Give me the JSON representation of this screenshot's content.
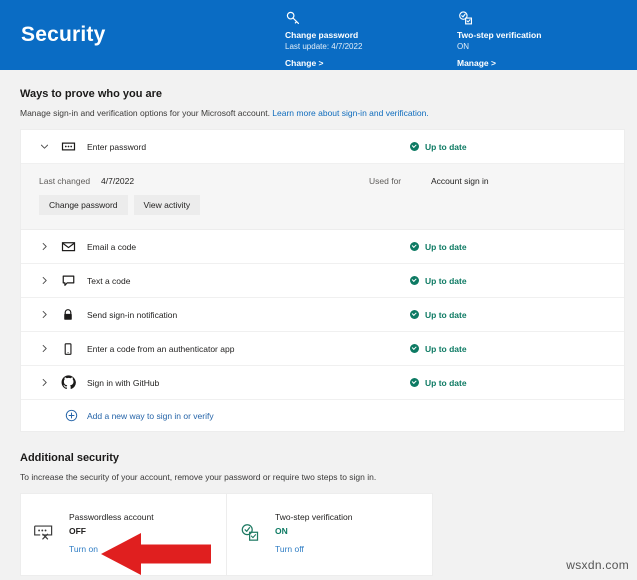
{
  "header": {
    "title": "Security",
    "cards": [
      {
        "icon": "key-icon",
        "name": "Change password",
        "sub": "Last update: 4/7/2022",
        "link": "Change >"
      },
      {
        "icon": "two-step-verification-icon",
        "name": "Two-step verification",
        "sub": "ON",
        "link": "Manage >"
      }
    ]
  },
  "ways_section": {
    "title": "Ways to prove who you are",
    "description_prefix": "Manage sign-in and verification options for your Microsoft account. ",
    "description_link": "Learn more about sign-in and verification.",
    "rows": [
      {
        "chevron": "chevron-down-icon",
        "icon": "password-dots-icon",
        "label": "Enter password",
        "status": "Up to date",
        "expanded": true
      },
      {
        "chevron": "chevron-right-icon",
        "icon": "envelope-icon",
        "label": "Email a code",
        "status": "Up to date",
        "expanded": false
      },
      {
        "chevron": "chevron-right-icon",
        "icon": "speech-bubble-icon",
        "label": "Text a code",
        "status": "Up to date",
        "expanded": false
      },
      {
        "chevron": "chevron-right-icon",
        "icon": "lock-icon",
        "label": "Send sign-in notification",
        "status": "Up to date",
        "expanded": false
      },
      {
        "chevron": "chevron-right-icon",
        "icon": "phone-icon",
        "label": "Enter a code from an authenticator app",
        "status": "Up to date",
        "expanded": false
      },
      {
        "chevron": "chevron-right-icon",
        "icon": "github-icon",
        "label": "Sign in with GitHub",
        "status": "Up to date",
        "expanded": false
      }
    ],
    "password_detail": {
      "last_changed_label": "Last changed",
      "last_changed_value": "4/7/2022",
      "used_for_label": "Used for",
      "used_for_value": "Account sign in",
      "change_password_button": "Change password",
      "view_activity_button": "View activity"
    },
    "add_row": {
      "icon": "plus-circle-icon",
      "label": "Add a new way to sign in or verify"
    }
  },
  "additional_section": {
    "title": "Additional security",
    "description": "To increase the security of your account, remove your password or require two steps to sign in.",
    "cards": [
      {
        "icon": "passwordless-icon",
        "title": "Passwordless account",
        "state": "OFF",
        "action": "Turn on"
      },
      {
        "icon": "two-step-check-icon",
        "title": "Two-step verification",
        "state": "ON",
        "action": "Turn off"
      }
    ]
  },
  "annotation": {
    "arrow": "red-arrow-pointing-left"
  },
  "watermark": "wsxdn.com",
  "colors": {
    "brand_blue": "#0a6cc4",
    "status_green": "#0d7a63",
    "link_blue": "#2f7dc4",
    "arrow_red": "#e01f1f"
  }
}
